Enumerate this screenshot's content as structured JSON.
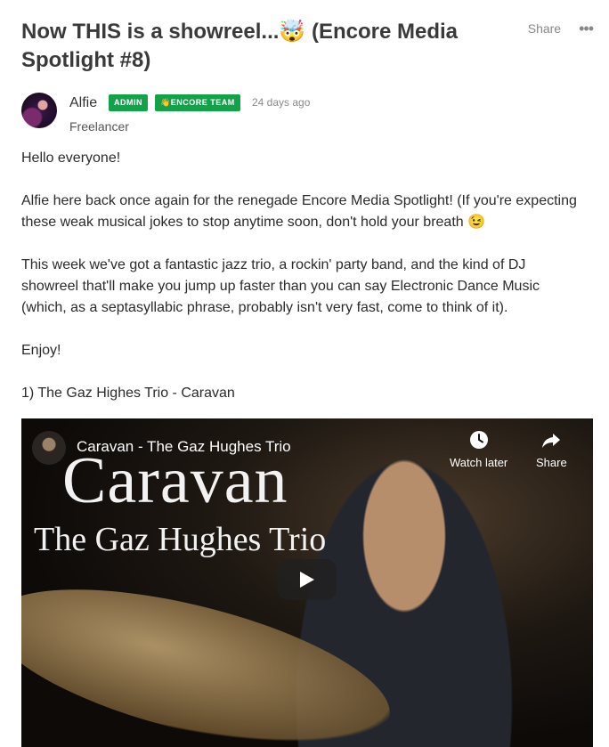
{
  "post": {
    "title": "Now THIS is a showreel...🤯 (Encore Media Spotlight #8)",
    "share_label": "Share",
    "more_label": "•••"
  },
  "author": {
    "name": "Alfie",
    "badge_admin": "ADMIN",
    "badge_team": "👋ENCORE TEAM",
    "time_ago": "24 days ago",
    "role": "Freelancer"
  },
  "body": {
    "paragraphs": [
      "Hello everyone!",
      "Alfie here back once again for the renegade Encore Media Spotlight! (If you're expecting these weak musical jokes to stop anytime soon, don't hold your breath 😉",
      "This week we've got a fantastic jazz trio, a rockin' party band, and the kind of DJ showreel that'll make you jump up faster than you can say Electronic Dance Music (which, as a septasyllabic phrase, probably isn't very fast, come to think of it).",
      "Enjoy!",
      "1) The Gaz Highes Trio - Caravan"
    ]
  },
  "video": {
    "title": "Caravan - The Gaz Hughes Trio",
    "watch_later_label": "Watch later",
    "share_label": "Share",
    "artwork_title": "Caravan",
    "artwork_subtitle": "The Gaz Hughes Trio"
  },
  "colors": {
    "badge_green": "#13a24a",
    "video_bg": "#0d0a08"
  }
}
